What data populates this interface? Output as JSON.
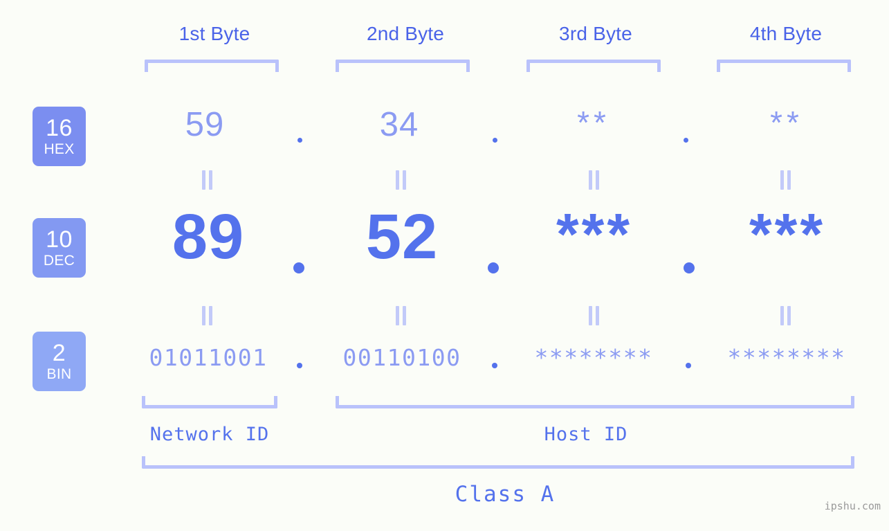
{
  "meta": {
    "background": "#fbfdf8",
    "accent": "#5472ec",
    "accent_light": "#8b9bf2",
    "bracket": "#b9c2fb"
  },
  "headers": [
    {
      "label": "1st Byte"
    },
    {
      "label": "2nd Byte"
    },
    {
      "label": "3rd Byte"
    },
    {
      "label": "4th Byte"
    }
  ],
  "bases": [
    {
      "num": "16",
      "label": "HEX",
      "color": "#7b8ef0"
    },
    {
      "num": "10",
      "label": "DEC",
      "color": "#8399f2"
    },
    {
      "num": "2",
      "label": "BIN",
      "color": "#8fa8f5"
    }
  ],
  "rows": {
    "hex": {
      "base_num": "16",
      "base_label": "HEX",
      "values": [
        "59",
        "34",
        "**",
        "**"
      ],
      "separator": "."
    },
    "dec": {
      "base_num": "10",
      "base_label": "DEC",
      "values": [
        "89",
        "52",
        "***",
        "***"
      ],
      "separator": "."
    },
    "bin": {
      "base_num": "2",
      "base_label": "BIN",
      "values": [
        "01011001",
        "00110100",
        "********",
        "********"
      ],
      "separator": "."
    }
  },
  "equality_marks": {
    "glyph": "||",
    "count_per_gap": 4
  },
  "segments": {
    "network_id": "Network ID",
    "host_id": "Host ID",
    "class": "Class A"
  },
  "watermark": "ipshu.com"
}
